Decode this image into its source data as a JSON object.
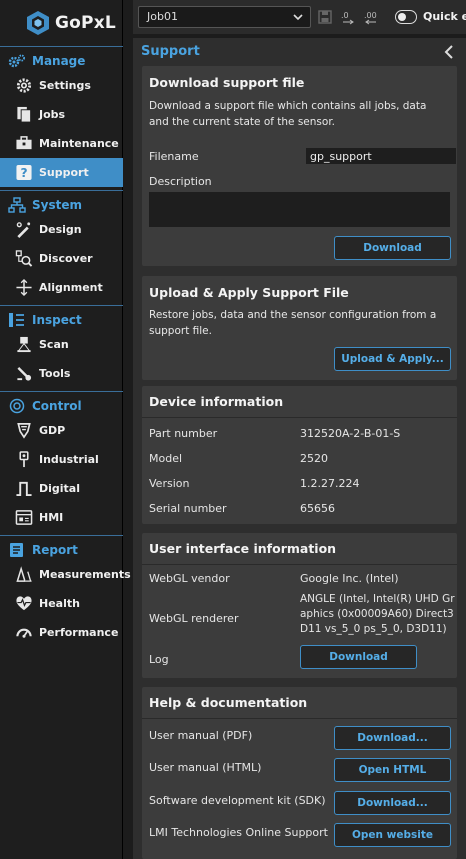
{
  "app": {
    "brand": "GoPxL"
  },
  "sidebar": {
    "sections": [
      {
        "label": "Manage",
        "items": [
          {
            "label": "Settings"
          },
          {
            "label": "Jobs"
          },
          {
            "label": "Maintenance"
          },
          {
            "label": "Support"
          }
        ]
      },
      {
        "label": "System",
        "items": [
          {
            "label": "Design"
          },
          {
            "label": "Discover"
          },
          {
            "label": "Alignment"
          }
        ]
      },
      {
        "label": "Inspect",
        "items": [
          {
            "label": "Scan"
          },
          {
            "label": "Tools"
          }
        ]
      },
      {
        "label": "Control",
        "items": [
          {
            "label": "GDP"
          },
          {
            "label": "Industrial"
          },
          {
            "label": "Digital"
          },
          {
            "label": "HMI"
          }
        ]
      },
      {
        "label": "Report",
        "items": [
          {
            "label": "Measurements"
          },
          {
            "label": "Health"
          },
          {
            "label": "Performance"
          }
        ]
      }
    ],
    "active_item": "Support"
  },
  "topbar": {
    "job": "Job01",
    "quick_edit_label": "Quick edit"
  },
  "panel": {
    "title": "Support"
  },
  "download_card": {
    "title": "Download support file",
    "description": "Download a support file which contains all jobs, data and the current state of the sensor.",
    "filename_label": "Filename",
    "filename_value": "gp_support",
    "description_label": "Description",
    "description_value": "",
    "button": "Download"
  },
  "upload_card": {
    "title": "Upload & Apply Support File",
    "description": "Restore jobs, data and the sensor configuration from a support file.",
    "button": "Upload & Apply..."
  },
  "device_card": {
    "title": "Device information",
    "rows": [
      {
        "label": "Part number",
        "value": "312520A-2-B-01-S"
      },
      {
        "label": "Model",
        "value": "2520"
      },
      {
        "label": "Version",
        "value": "1.2.27.224"
      },
      {
        "label": "Serial number",
        "value": "65656"
      }
    ]
  },
  "ui_card": {
    "title": "User interface information",
    "vendor_label": "WebGL vendor",
    "vendor_value": "Google Inc. (Intel)",
    "renderer_label": "WebGL renderer",
    "renderer_value": "ANGLE (Intel, Intel(R) UHD Graphics (0x00009A60) Direct3D11 vs_5_0 ps_5_0, D3D11)",
    "log_label": "Log",
    "log_button": "Download"
  },
  "help_card": {
    "title": "Help & documentation",
    "rows": [
      {
        "label": "User manual (PDF)",
        "button": "Download..."
      },
      {
        "label": "User manual (HTML)",
        "button": "Open HTML"
      },
      {
        "label": "Software development kit (SDK)",
        "button": "Download..."
      },
      {
        "label": "LMI Technologies Online Support",
        "button": "Open website"
      }
    ]
  },
  "colors": {
    "accent": "#3f8ec7",
    "accent_text": "#4aa3e0",
    "background": "#1c1c1c",
    "card": "#3c3c3c"
  }
}
